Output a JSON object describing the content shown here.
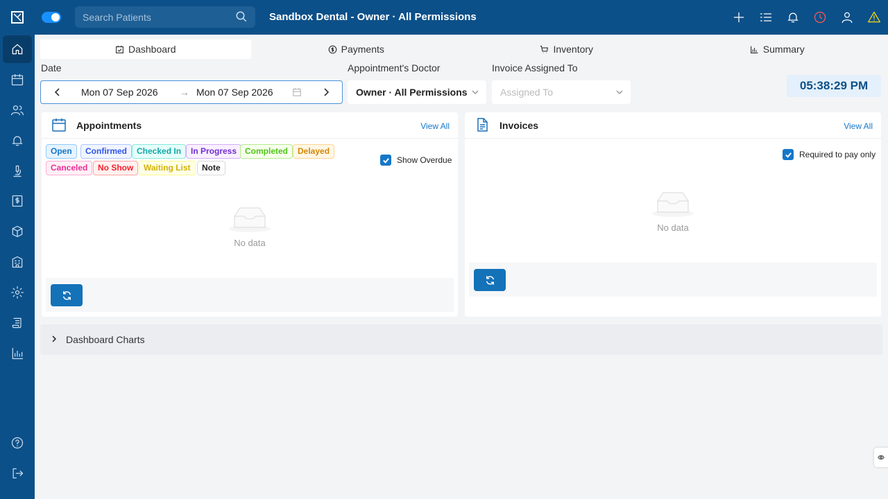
{
  "topbar": {
    "search_placeholder": "Search Patients",
    "title": "Sandbox Dental - Owner · All Permissions"
  },
  "tabs": [
    {
      "label": "Dashboard",
      "icon": "calendar-check-icon",
      "active": true
    },
    {
      "label": "Payments",
      "icon": "dollar-circle-icon",
      "active": false
    },
    {
      "label": "Inventory",
      "icon": "cart-icon",
      "active": false
    },
    {
      "label": "Summary",
      "icon": "bar-chart-icon",
      "active": false
    }
  ],
  "filters": {
    "date_label": "Date",
    "date_start": "Mon 07 Sep 2026",
    "date_arrow": "→",
    "date_end": "Mon 07 Sep 2026",
    "doctor_label": "Appointment's Doctor",
    "doctor_value": "Owner · All Permissions",
    "invoice_label": "Invoice Assigned To",
    "invoice_placeholder": "Assigned To"
  },
  "clock": "05:38:29 PM",
  "appointments": {
    "title": "Appointments",
    "view_all": "View All",
    "statuses": [
      {
        "label": "Open",
        "color": "#1677c9"
      },
      {
        "label": "Confirmed",
        "color": "#2f54eb"
      },
      {
        "label": "Checked In",
        "color": "#13a8a8"
      },
      {
        "label": "In Progress",
        "color": "#722ed1"
      },
      {
        "label": "Completed",
        "color": "#52c41a"
      },
      {
        "label": "Delayed",
        "color": "#d48806"
      },
      {
        "label": "Canceled",
        "color": "#eb2f96"
      },
      {
        "label": "No Show",
        "color": "#f5222d"
      },
      {
        "label": "Waiting List",
        "color": "#d4b106"
      },
      {
        "label": "Note",
        "color": "#222222"
      }
    ],
    "show_overdue": "Show Overdue",
    "empty": "No data"
  },
  "invoices": {
    "title": "Invoices",
    "view_all": "View All",
    "required_to_pay": "Required to pay only",
    "empty": "No data"
  },
  "charts_section": {
    "title": "Dashboard Charts"
  }
}
